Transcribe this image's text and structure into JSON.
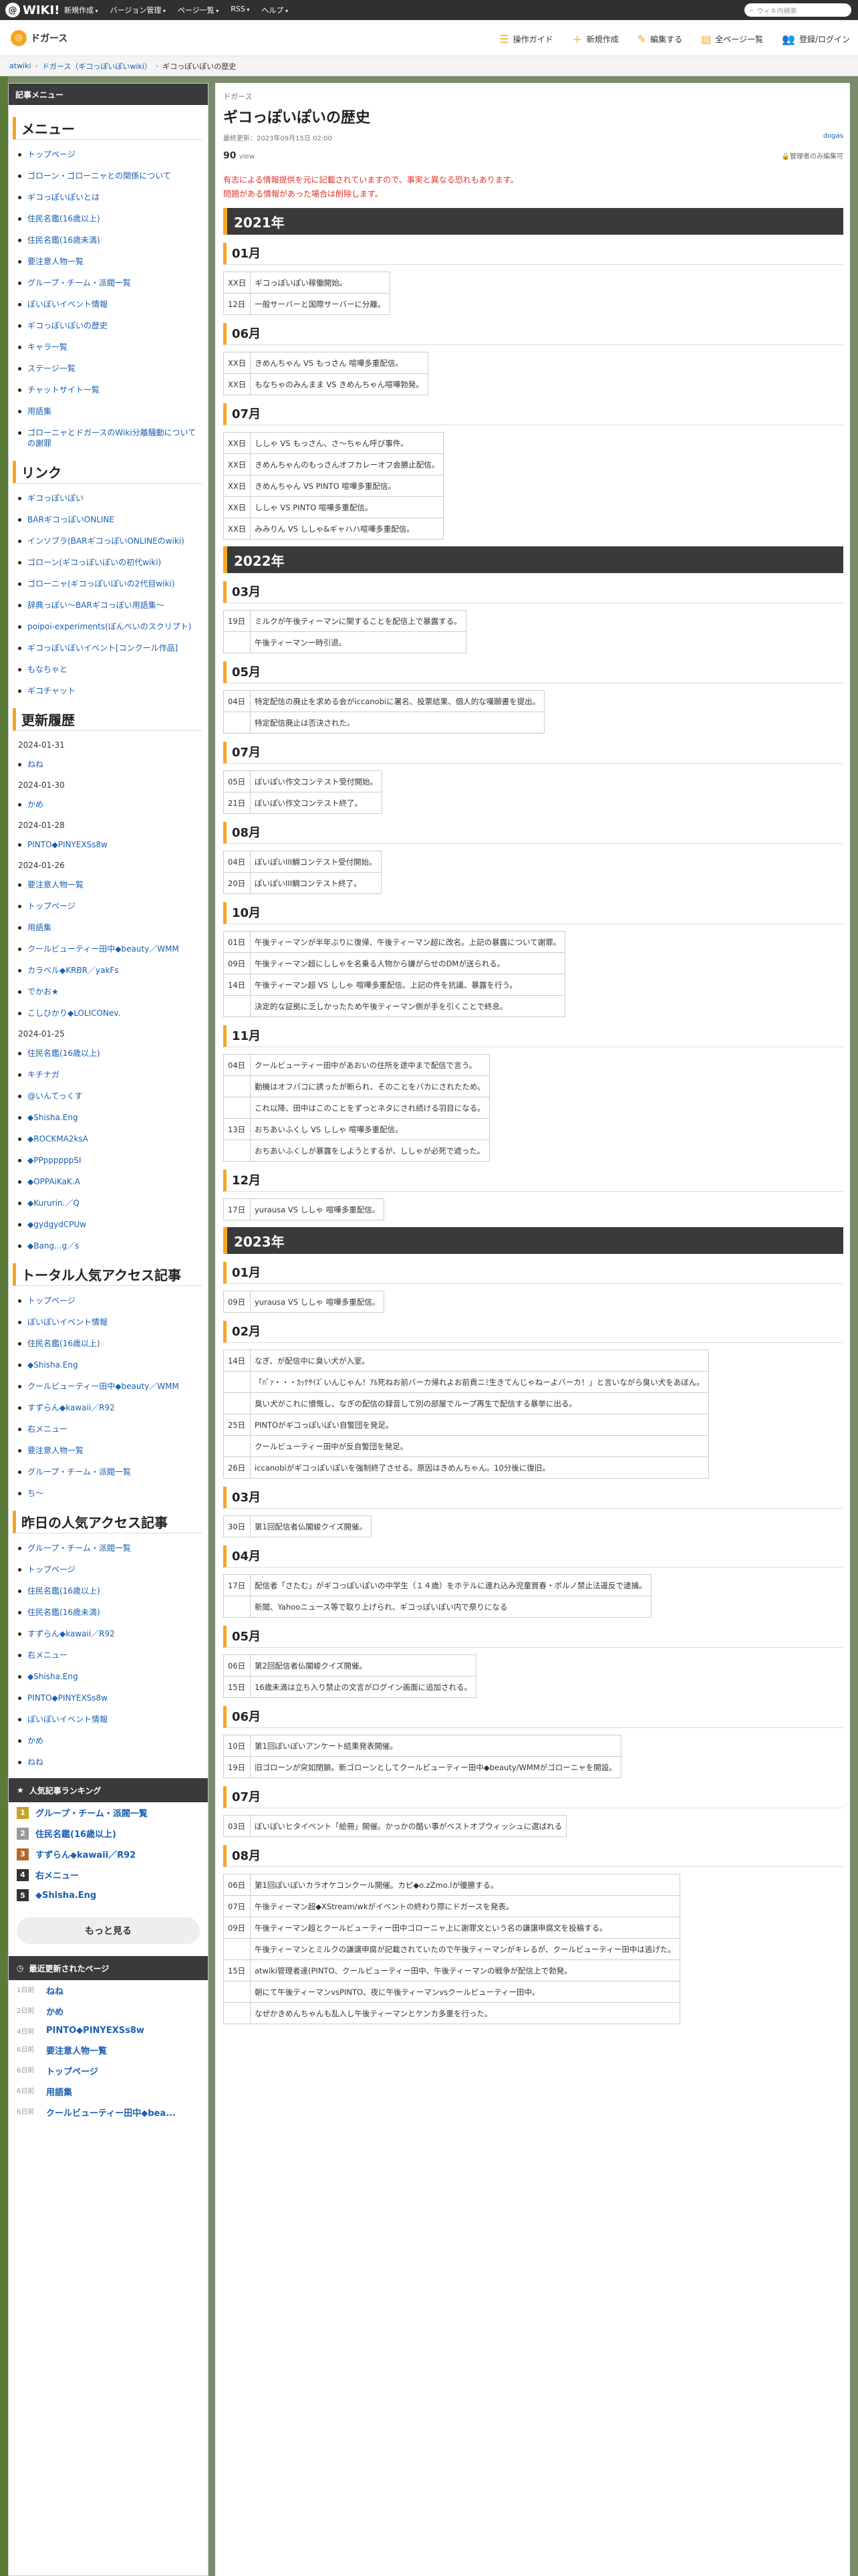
{
  "topbar": {
    "logo": "WIKI!",
    "menu": [
      "新規作成",
      "バージョン管理",
      "ページ一覧",
      "RSS",
      "ヘルプ"
    ],
    "search_placeholder": "ウィキ内検索"
  },
  "header": {
    "wiki_name": "ドガース",
    "tools": [
      "操作ガイド",
      "新規作成",
      "編集する",
      "全ページ一覧",
      "登録/ログイン"
    ]
  },
  "breadcrumb": [
    "atwiki",
    "ドガース（ギコっぽいぽいwiki）",
    "ギコっぽいぽいの歴史"
  ],
  "sidebar": {
    "title": "記事メニュー",
    "menu_heading": "メニュー",
    "menu": [
      "トップページ",
      "ゴローン・ゴローニャとの関係について",
      "ギコっぽいぽいとは",
      "住民名鑑(16歳以上)",
      "住民名鑑(16歳未満)",
      "要注意人物一覧",
      "グループ・チーム・派閥一覧",
      "ぽいぽいイベント情報",
      "ギコっぽいぽいの歴史",
      "キャラ一覧",
      "ステージ一覧",
      "チャットサイト一覧",
      "用語集",
      "ゴローニャとドガースのWiki分離騒動についての謝罪"
    ],
    "links_heading": "リンク",
    "links": [
      "ギコっぽいぽい",
      "BARギコっぽいONLINE",
      "インソブラ(BARギコっぽいONLINEのwiki)",
      "ゴローン(ギコっぽいぽいの初代wiki)",
      "ゴローニャ(ギコっぽいぽいの2代目wiki)",
      "辞典っぽい〜BARギコっぽい用語集〜",
      "poipoi-experiments(ぽんぺいのスクリプト)",
      "ギコっぽいぽいイベント[コンクール作品]",
      "もなちゃと",
      "ギコチャット"
    ],
    "updates_heading": "更新履歴",
    "updates": [
      {
        "date": "2024-01-31",
        "items": [
          "ねね"
        ]
      },
      {
        "date": "2024-01-30",
        "items": [
          "かめ"
        ]
      },
      {
        "date": "2024-01-28",
        "items": [
          "PINTO◆PINYEXSs8w"
        ]
      },
      {
        "date": "2024-01-26",
        "items": [
          "要注意人物一覧",
          "トップページ",
          "用語集",
          "クールビューティー田中◆beauty／WMM",
          "カラベル◆KRBR／yakFs",
          "でかお★",
          "こしひかり◆LOLICONev."
        ]
      },
      {
        "date": "2024-01-25",
        "items": [
          "住民名鑑(16歳以上)",
          "キチナガ",
          "@いんてっくす",
          "◆Shisha.Eng",
          "◆ROCKMA2ksA",
          "◆PPppppppSI",
          "◆OPPAiKaK.A",
          "◆Kururin.／Q",
          "◆gydgydCPUw",
          "◆Bang...g／s"
        ]
      }
    ],
    "total_heading": "トータル人気アクセス記事",
    "total": [
      "トップページ",
      "ぽいぽいイベント情報",
      "住民名鑑(16歳以上)",
      "◆Shisha.Eng",
      "クールビューティー田中◆beauty／WMM",
      "すずらん◆kawaii／R92",
      "右メニュー",
      "要注意人物一覧",
      "グループ・チーム・派閥一覧",
      "ち〜"
    ],
    "yesterday_heading": "昨日の人気アクセス記事",
    "yesterday": [
      "グループ・チーム・派閥一覧",
      "トップページ",
      "住民名鑑(16歳以上)",
      "住民名鑑(16歳未満)",
      "すずらん◆kawaii／R92",
      "右メニュー",
      "◆Shisha.Eng",
      "PINTO◆PINYEXSs8w",
      "ぽいぽいイベント情報",
      "かめ",
      "ねね"
    ],
    "ranking_heading": "人気記事ランキング",
    "ranking": [
      "グループ・チーム・派閥一覧",
      "住民名鑑(16歳以上)",
      "すずらん◆kawaii／R92",
      "右メニュー",
      "◆Shisha.Eng"
    ],
    "rank_colors": [
      "#c9a227",
      "#9a9a9a",
      "#b06a2a",
      "#333333",
      "#333333"
    ],
    "more_label": "もっと見る",
    "recent_heading": "最近更新されたページ",
    "recent": [
      {
        "ago": "1日前",
        "title": "ねね"
      },
      {
        "ago": "2日前",
        "title": "かめ"
      },
      {
        "ago": "4日前",
        "title": "PINTO◆PINYEXSs8w"
      },
      {
        "ago": "6日前",
        "title": "要注意人物一覧"
      },
      {
        "ago": "6日前",
        "title": "トップページ"
      },
      {
        "ago": "6日前",
        "title": "用語集"
      },
      {
        "ago": "6日前",
        "title": "クールビューティー田中◆bea..."
      }
    ]
  },
  "main": {
    "category": "ドガース",
    "title": "ギコっぽいぽいの歴史",
    "updated": "最終更新：2023年09月15日 02:00",
    "author": "dogas",
    "views": "90",
    "views_unit": "view",
    "lock": "管理者のみ編集可",
    "warning": [
      "有志による情報提供を元に記載されていますので、事実と異なる恐れもあります。",
      "問題がある情報があった場合は削除します。"
    ],
    "years": [
      {
        "year": "2021年",
        "months": [
          {
            "month": "01月",
            "rows": [
              [
                "XX日",
                "ギコっぽいぽい稼働開始。"
              ],
              [
                "12日",
                "一般サーバーと国際サーバーに分離。"
              ]
            ]
          },
          {
            "month": "06月",
            "rows": [
              [
                "XX日",
                "きめんちゃん VS もっさん 喧嘩多重配信。"
              ],
              [
                "XX日",
                "もなちゃのみんまま VS きめんちゃん喧嘩勃発。"
              ]
            ]
          },
          {
            "month": "07月",
            "rows": [
              [
                "XX日",
                "ししゃ VS もっさん、さ～ちゃん呼び事件。"
              ],
              [
                "XX日",
                "きめんちゃんのもっさんオフカレーオフ会勝止配信。"
              ],
              [
                "XX日",
                "きめんちゃん VS PINTO 喧嘩多重配信。"
              ],
              [
                "XX日",
                "ししゃ VS PINTO 喧嘩多重配信。"
              ],
              [
                "XX日",
                "みみりん VS ししゃ&ギャハハ喧嘩多重配信。"
              ]
            ]
          }
        ]
      },
      {
        "year": "2022年",
        "months": [
          {
            "month": "03月",
            "rows": [
              [
                "19日",
                "ミルクが午後ティーマンに関することを配信上で暴露する。"
              ],
              [
                "",
                "午後ティーマン一時引退。"
              ]
            ]
          },
          {
            "month": "05月",
            "rows": [
              [
                "04日",
                "特定配信の廃止を求める会がiccanobiに署名、投票結果、個人的な嘆願書を提出。"
              ],
              [
                "",
                "特定配信廃止は否決された。"
              ]
            ]
          },
          {
            "month": "07月",
            "rows": [
              [
                "05日",
                "ぽいぽい作文コンテスト受付開始。"
              ],
              [
                "21日",
                "ぽいぽい作文コンテスト終了。"
              ]
            ]
          },
          {
            "month": "08月",
            "rows": [
              [
                "04日",
                "ぽいぽいIII鯛コンテスト受付開始。"
              ],
              [
                "20日",
                "ぽいぽいIII鯛コンテスト終了。"
              ]
            ]
          },
          {
            "month": "10月",
            "rows": [
              [
                "01日",
                "午後ティーマンが半年ぶりに復帰、午後ティーマン超に改名。上記の暴露について謝罪。"
              ],
              [
                "09日",
                "午後ティーマン超にししゃを名乗る人物から嫌がらせのDMが送られる。"
              ],
              [
                "14日",
                "午後ティーマン超 VS ししゃ 喧嘩多重配信。上記の件を抗議、暴露を行う。"
              ],
              [
                "",
                "決定的な証拠に乏しかったため午後ティーマン側が手を引くことで終息。"
              ]
            ]
          },
          {
            "month": "11月",
            "rows": [
              [
                "04日",
                "クールビューティー田中があおいの住所を途中まで配信で言う。"
              ],
              [
                "",
                "勤機はオフパコに誘ったが断られ、そのことをバカにされたため。"
              ],
              [
                "",
                "これ以降、田中はこのことをずっとネタにされ続ける羽目になる。"
              ],
              [
                "13日",
                "おちあいふくし VS ししゃ 喧嘩多重配信。"
              ],
              [
                "",
                "おちあいふくしが暴露をしようとするが、ししゃが必死で遮った。"
              ]
            ]
          },
          {
            "month": "12月",
            "rows": [
              [
                "17日",
                "yurausa VS ししゃ 喧嘩多重配信。"
              ]
            ]
          }
        ]
      },
      {
        "year": "2023年",
        "months": [
          {
            "month": "01月",
            "rows": [
              [
                "09日",
                "yurausa VS ししゃ 喧嘩多重配信。"
              ]
            ]
          },
          {
            "month": "02月",
            "rows": [
              [
                "14日",
                "なぎ、が配信中に臭い犬が入室。"
              ],
              [
                "",
                "「ﾊﾟｧ・・・ｶｯｹｻｲｽﾞいんじゃん！ｱﾙ死ねお前バーカ帰れよお前貢ニﾐ生きてんじゃねーよバーカ！」と言いながら臭い犬をあぼん。"
              ],
              [
                "",
                "臭い犬がこれに憤慨し、なぎの配信の録音して別の部屋でループ再生で配信する暴挙に出る。"
              ],
              [
                "25日",
                "PINTOがギコっぽいぽい自警団を発足。"
              ],
              [
                "",
                "クールビューティー田中が反自警団を発足。"
              ],
              [
                "26日",
                "iccanobiがギコっぽいぽいを強制終了させる。原因はきめんちゃん。10分後に復旧。"
              ]
            ]
          },
          {
            "month": "03月",
            "rows": [
              [
                "30日",
                "第1回配信者仏閣峻クイズ開催。"
              ]
            ]
          },
          {
            "month": "04月",
            "rows": [
              [
                "17日",
                "配信者「さたむ」がギコっぽいぽいの中学生（１４歳）をホテルに連れ込み児童買春・ポルノ禁止法違反で逮捕。"
              ],
              [
                "",
                "新聞、Yahooニュース等で取り上げられ、ギコっぽいぽい内で祭りになる"
              ]
            ]
          },
          {
            "month": "05月",
            "rows": [
              [
                "06日",
                "第2回配信者仏閣峻クイズ開催。"
              ],
              [
                "15日",
                "16歳未満は立ち入り禁止の文言がログイン画面に追加される。"
              ]
            ]
          },
          {
            "month": "06月",
            "rows": [
              [
                "10日",
                "第1回ぽいぽいアンケート結果発表開催。"
              ],
              [
                "19日",
                "旧ゴローンが突如閉鎖。新ゴローンとしてクールビューティー田中◆beauty/WMMがゴローニャを開設。"
              ]
            ]
          },
          {
            "month": "07月",
            "rows": [
              [
                "03日",
                "ぽいぽいヒタイベント「絵冊」開催。かっかの酷い事がベストオブウィッシュに選ばれる"
              ]
            ]
          },
          {
            "month": "08月",
            "rows": [
              [
                "06日",
                "第1回ぽいぽいカラオケコンクール開催。カビ◆o.zZmo.lが優勝する。"
              ],
              [
                "07日",
                "午後ティーマン超◆XStream/wkがイベントの終わり際にドガースを発表。"
              ],
              [
                "09日",
                "午後ティーマン超とクールビューティー田中ゴローニャ上に謝罪文という名の謙譲申腐文を投稿する。"
              ],
              [
                "",
                "午後ティーマンとミルクの謙譲申腐が記載されていたので午後ティーマンがキレるが、クールビューティー田中は逃げた。"
              ],
              [
                "15日",
                "atwiki管理者達(PINTO、クールビューティー田中、午後ティーマンの戦争が配信上で勃発。"
              ],
              [
                "",
                "朝にて午後ティーマンvsPINTO、夜に午後ティーマンvsクールビューティー田中。"
              ],
              [
                "",
                "なぜかきめんちゃんも乱入し午後ティーマンとケンカ多重を行った。"
              ]
            ]
          }
        ]
      }
    ]
  }
}
